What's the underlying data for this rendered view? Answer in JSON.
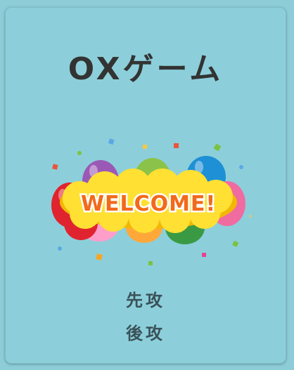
{
  "app": {
    "title": "OXゲーム",
    "banner_text": "WELCOME!",
    "options": [
      {
        "label": "先攻"
      },
      {
        "label": "後攻"
      }
    ]
  },
  "colors": {
    "background": "#8ccfda",
    "title": "#333333",
    "option_text": "#3a5159",
    "banner_fill": "#ffe033",
    "banner_text": "#f26a1b"
  },
  "icons": {
    "banner": "welcome-balloons-illustration"
  }
}
